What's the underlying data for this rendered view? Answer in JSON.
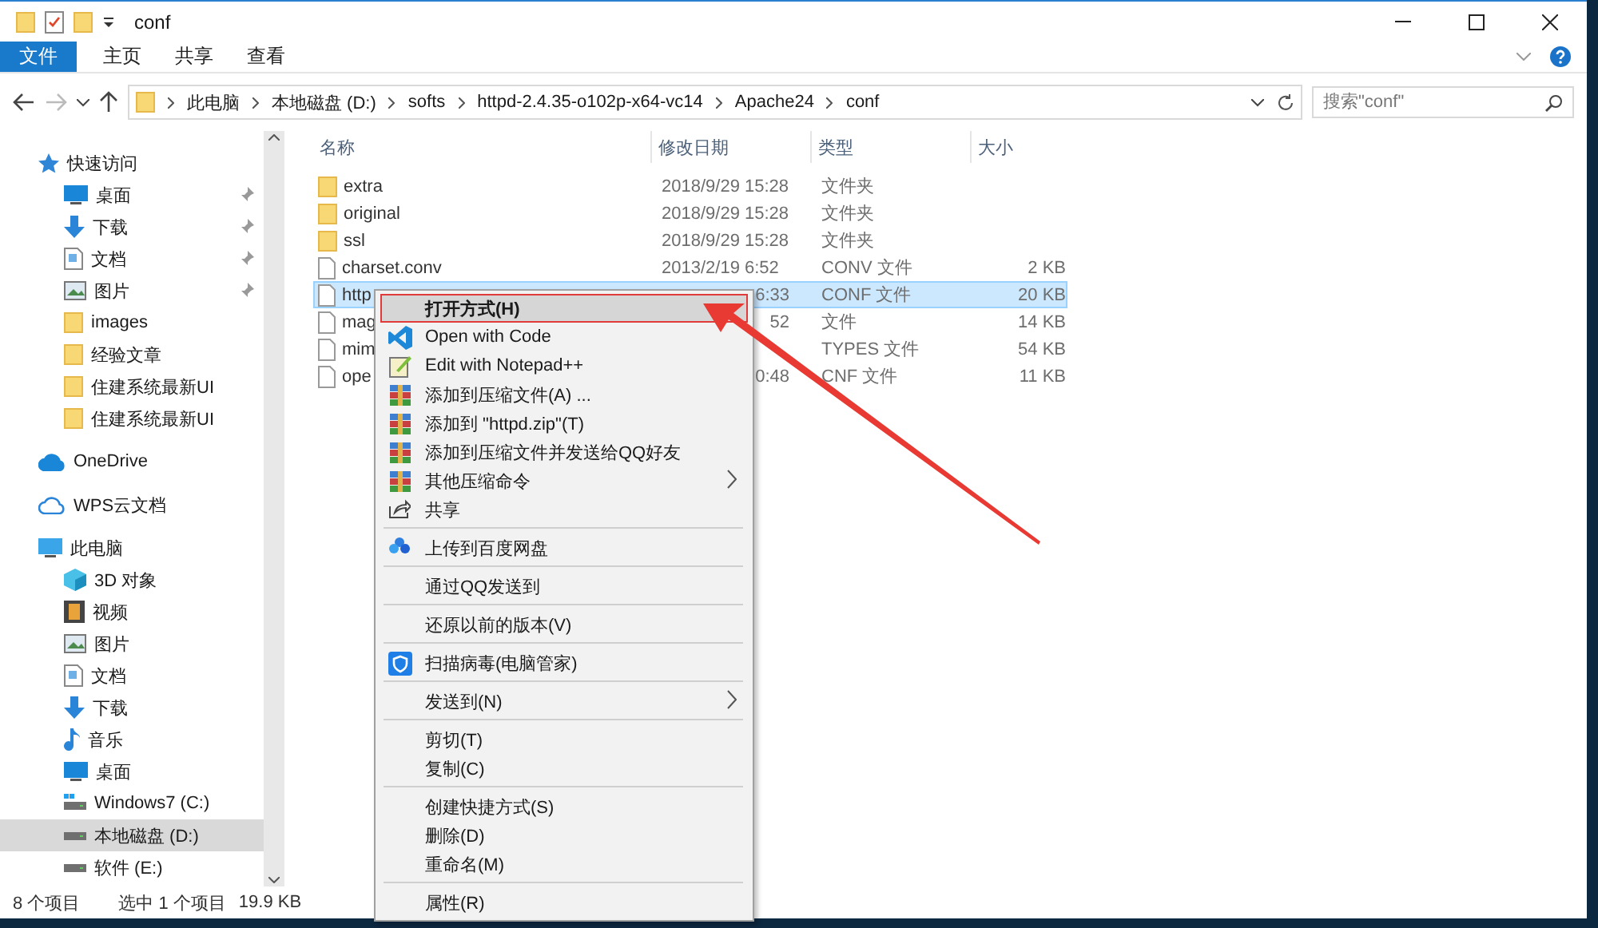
{
  "window": {
    "title": "conf"
  },
  "ribbon_tabs": [
    {
      "label": "文件",
      "selected": true
    },
    {
      "label": "主页",
      "selected": false
    },
    {
      "label": "共享",
      "selected": false
    },
    {
      "label": "查看",
      "selected": false
    }
  ],
  "breadcrumb": [
    "此电脑",
    "本地磁盘 (D:)",
    "softs",
    "httpd-2.4.35-o102p-x64-vc14",
    "Apache24",
    "conf"
  ],
  "search": {
    "placeholder": "搜索\"conf\""
  },
  "sidebar": [
    {
      "label": "快速访问",
      "selected": false,
      "children": [
        {
          "label": "桌面",
          "pinned": true,
          "selected": false
        },
        {
          "label": "下载",
          "pinned": true,
          "selected": false
        },
        {
          "label": "文档",
          "pinned": true,
          "selected": false
        },
        {
          "label": "图片",
          "pinned": true,
          "selected": false
        },
        {
          "label": "images",
          "pinned": false,
          "selected": false
        },
        {
          "label": "经验文章",
          "pinned": false,
          "selected": false
        },
        {
          "label": "住建系统最新UI",
          "pinned": false,
          "selected": false
        },
        {
          "label": "住建系统最新UI",
          "pinned": false,
          "selected": false
        }
      ]
    },
    {
      "label": "OneDrive",
      "selected": false
    },
    {
      "label": "WPS云文档",
      "selected": false
    },
    {
      "label": "此电脑",
      "selected": false,
      "children": [
        {
          "label": "3D 对象",
          "selected": false
        },
        {
          "label": "视频",
          "selected": false
        },
        {
          "label": "图片",
          "selected": false
        },
        {
          "label": "文档",
          "selected": false
        },
        {
          "label": "下载",
          "selected": false
        },
        {
          "label": "音乐",
          "selected": false
        },
        {
          "label": "桌面",
          "selected": false
        },
        {
          "label": "Windows7 (C:)",
          "selected": false
        },
        {
          "label": "本地磁盘 (D:)",
          "selected": true
        },
        {
          "label": "软件 (E:)",
          "selected": false
        }
      ]
    }
  ],
  "table": {
    "columns": [
      "名称",
      "修改日期",
      "类型",
      "大小"
    ],
    "rows": [
      {
        "kind": "folder",
        "name": "extra",
        "date": "2018/9/29 15:28",
        "type": "文件夹",
        "selected": false
      },
      {
        "kind": "folder",
        "name": "original",
        "date": "2018/9/29 15:28",
        "type": "文件夹",
        "selected": false
      },
      {
        "kind": "folder",
        "name": "ssl",
        "date": "2018/9/29 15:28",
        "type": "文件夹",
        "selected": false
      },
      {
        "kind": "file",
        "name": "charset.conv",
        "date": "2013/2/19 6:52",
        "type": "CONV 文件",
        "size": "2 KB",
        "selected": false
      },
      {
        "kind": "file",
        "name": "http",
        "date": "6:33",
        "date_clipped": true,
        "type": "CONF 文件",
        "size": "20 KB",
        "selected": true
      },
      {
        "kind": "file",
        "name": "mag",
        "date": "52",
        "date_clipped": true,
        "type": "文件",
        "size": "14 KB",
        "selected": false
      },
      {
        "kind": "file",
        "name": "mim",
        "type": "TYPES 文件",
        "size": "54 KB",
        "selected": false
      },
      {
        "kind": "file",
        "name": "ope",
        "date": "0:48",
        "date_clipped": true,
        "type": "CNF 文件",
        "size": "11 KB",
        "selected": false
      }
    ]
  },
  "status_bar": [
    "8 个项目",
    "选中 1 个项目",
    "19.9 KB"
  ],
  "context_menu": [
    [
      {
        "label": "打开方式(H)",
        "bold": true,
        "highlighted": true
      },
      {
        "label": "Open with Code"
      },
      {
        "label": "Edit with Notepad++"
      },
      {
        "label": "添加到压缩文件(A) ..."
      },
      {
        "label": "添加到 \"httpd.zip\"(T)"
      },
      {
        "label": "添加到压缩文件并发送给QQ好友"
      },
      {
        "label": "其他压缩命令",
        "submenu": true
      },
      {
        "label": "共享"
      }
    ],
    [
      {
        "label": "上传到百度网盘"
      }
    ],
    [
      {
        "label": "通过QQ发送到"
      }
    ],
    [
      {
        "label": "还原以前的版本(V)"
      }
    ],
    [
      {
        "label": "扫描病毒(电脑管家)"
      }
    ],
    [
      {
        "label": "发送到(N)",
        "submenu": true
      }
    ],
    [
      {
        "label": "剪切(T)"
      },
      {
        "label": "复制(C)"
      }
    ],
    [
      {
        "label": "创建快捷方式(S)"
      },
      {
        "label": "删除(D)"
      },
      {
        "label": "重命名(M)"
      }
    ],
    [
      {
        "label": "属性(R)"
      }
    ]
  ]
}
